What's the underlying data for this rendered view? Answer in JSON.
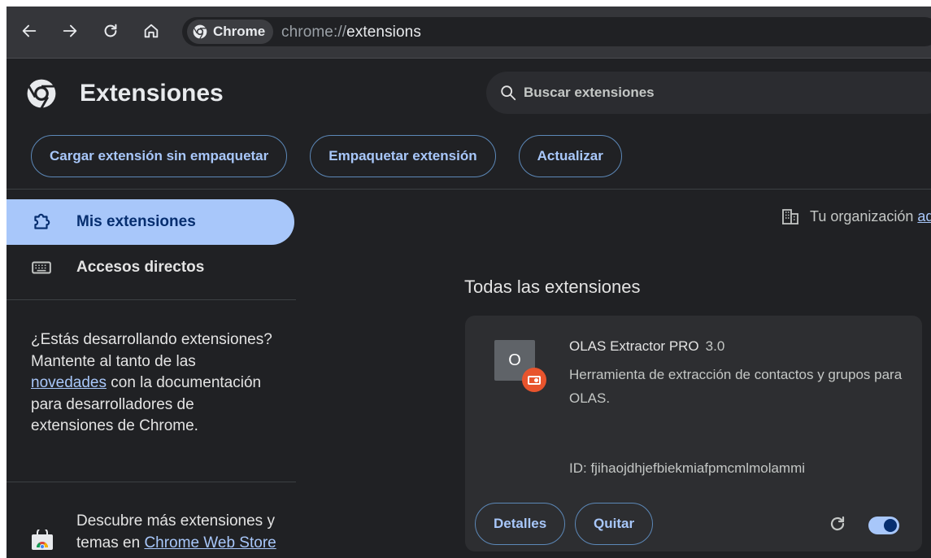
{
  "browser": {
    "chip_label": "Chrome",
    "url_scheme": "chrome://",
    "url_path": "extensions"
  },
  "header": {
    "title": "Extensiones",
    "search_placeholder": "Buscar extensiones"
  },
  "dev_buttons": {
    "load_unpacked": "Cargar extensión sin empaquetar",
    "pack": "Empaquetar extensión",
    "update": "Actualizar"
  },
  "sidebar": {
    "items": [
      {
        "label": "Mis extensiones",
        "icon": "puzzle-icon",
        "active": true
      },
      {
        "label": "Accesos directos",
        "icon": "keyboard-icon",
        "active": false
      }
    ],
    "dev_note": {
      "before": "¿Estás desarrollando extensiones? Mantente al tanto de las ",
      "link": "novedades",
      "after": " con la documentación para desarrolladores de extensiones de Chrome."
    },
    "webstore": {
      "before": "Descubre más extensiones y temas en ",
      "link": "Chrome Web Store"
    }
  },
  "main": {
    "org_notice": "Tu organización",
    "org_link": "ad",
    "section_title": "Todas las extensiones",
    "extension": {
      "icon_letter": "O",
      "name": "OLAS Extractor PRO",
      "version": "3.0",
      "description": "Herramienta de extracción de contactos y grupos para OLAS.",
      "id": "ID: fjihaojdhjefbiekmiafpmcmlmolammi",
      "details_label": "Detalles",
      "remove_label": "Quitar",
      "enabled": true
    }
  },
  "colors": {
    "background": "#202124",
    "accent": "#a8c7fa",
    "active_item_text": "#062e6f",
    "badge": "#e8542d"
  }
}
